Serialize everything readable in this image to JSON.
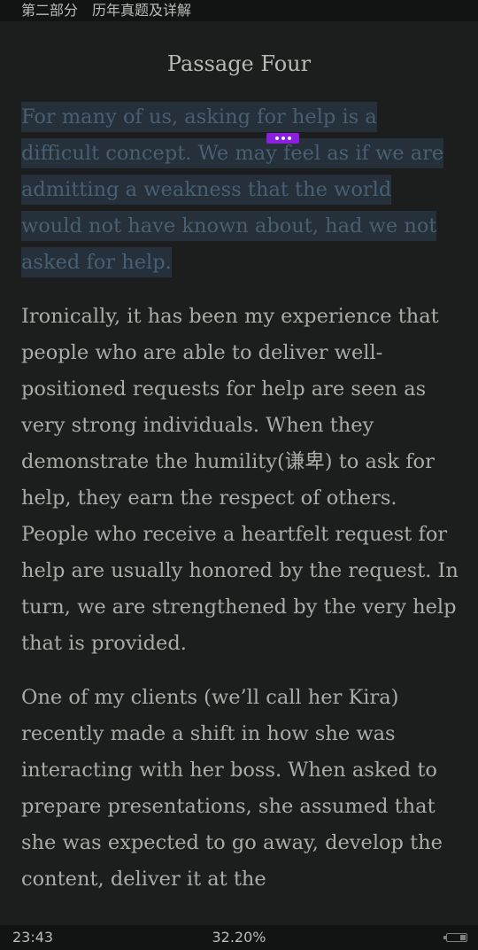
{
  "header": {
    "breadcrumb": "第二部分　历年真题及详解"
  },
  "title": "Passage Four",
  "paragraphs": [
    {
      "text": "For many of us, asking for help is a difficult concept. We may feel as if we are admitting a weakness that the world would not have known about, had we not asked for help.",
      "selected": true
    },
    {
      "text": "Ironically, it has been my experience that people who are able to deliver well-positioned requests for help are seen as very strong individuals. When they demonstrate the humility(谦卑) to ask for help, they earn the respect of others. People who receive a heartfelt request for help are usually honored by the request. In turn, we are strengthened by the very help that is provided.",
      "selected": false
    },
    {
      "text": "One of my clients (we’ll call her Kira) recently made a shift in how she was interacting with her boss. When asked to prepare presentations, she assumed that she was expected to go away, develop the content, deliver it at the",
      "selected": false
    }
  ],
  "status": {
    "time": "23:43",
    "progress": "32.20%",
    "battery_level": 0.3
  },
  "colors": {
    "background": "#1b1e1d",
    "text": "#a9aca7",
    "selection_bg": "#25303b",
    "selection_text": "#4a5f71",
    "handle": "#8b1fe0"
  }
}
